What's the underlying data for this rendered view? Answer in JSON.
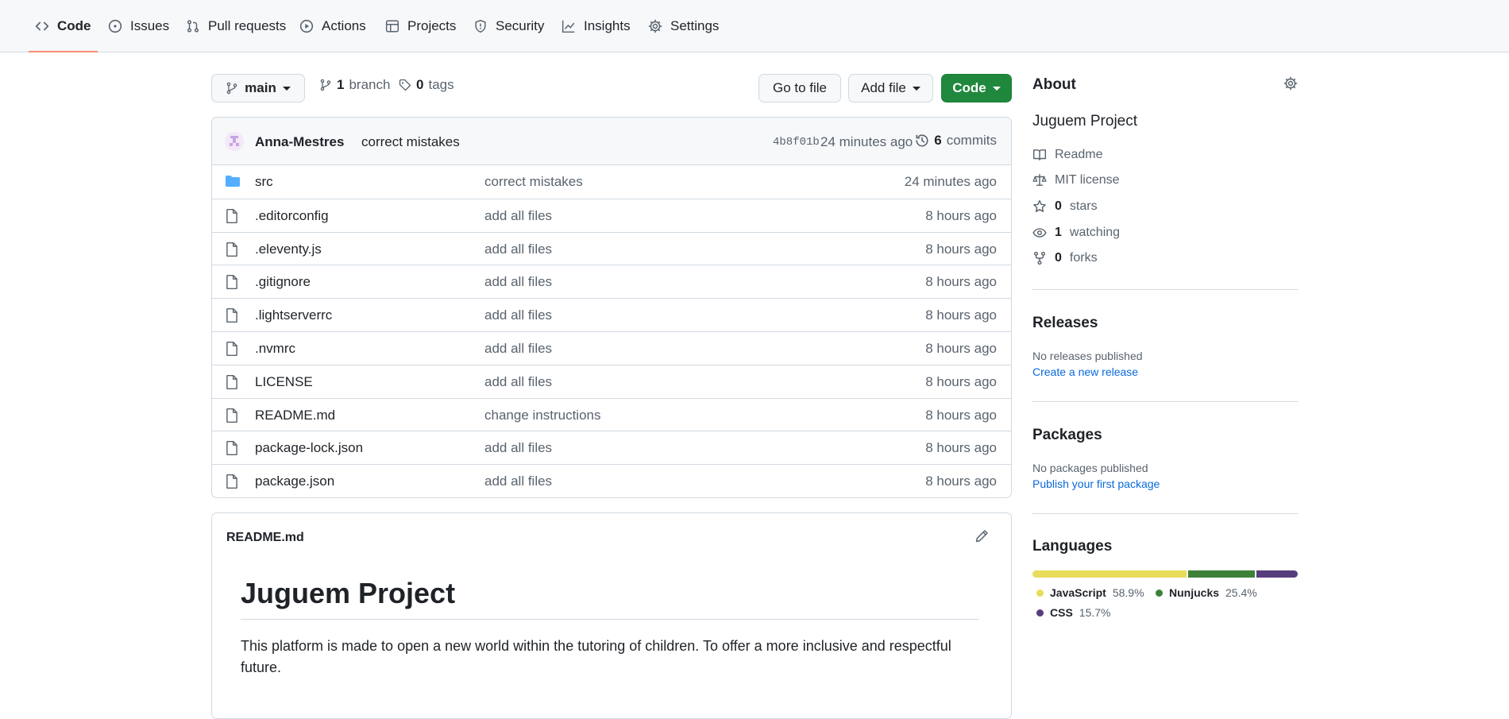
{
  "nav": {
    "tabs": [
      {
        "label": "Code",
        "icon": "code-icon"
      },
      {
        "label": "Issues",
        "icon": "issue-icon"
      },
      {
        "label": "Pull requests",
        "icon": "pull-request-icon"
      },
      {
        "label": "Actions",
        "icon": "play-icon"
      },
      {
        "label": "Projects",
        "icon": "table-icon"
      },
      {
        "label": "Security",
        "icon": "shield-icon"
      },
      {
        "label": "Insights",
        "icon": "graph-icon"
      },
      {
        "label": "Settings",
        "icon": "gear-icon"
      }
    ],
    "active": "Code"
  },
  "toolbar": {
    "branch": "main",
    "branch_count": "1",
    "branch_label": "branch",
    "tag_count": "0",
    "tag_label": "tags",
    "go_to_file": "Go to file",
    "add_file": "Add file",
    "code": "Code"
  },
  "commit": {
    "author": "Anna-Mestres",
    "message": "correct mistakes",
    "sha": "4b8f01b",
    "time": "24 minutes ago",
    "count": "6",
    "count_label": "commits"
  },
  "files": [
    {
      "name": "src",
      "type": "folder",
      "message": "correct mistakes",
      "time": "24 minutes ago"
    },
    {
      "name": ".editorconfig",
      "type": "file",
      "message": "add all files",
      "time": "8 hours ago"
    },
    {
      "name": ".eleventy.js",
      "type": "file",
      "message": "add all files",
      "time": "8 hours ago"
    },
    {
      "name": ".gitignore",
      "type": "file",
      "message": "add all files",
      "time": "8 hours ago"
    },
    {
      "name": ".lightserverrc",
      "type": "file",
      "message": "add all files",
      "time": "8 hours ago"
    },
    {
      "name": ".nvmrc",
      "type": "file",
      "message": "add all files",
      "time": "8 hours ago"
    },
    {
      "name": "LICENSE",
      "type": "file",
      "message": "add all files",
      "time": "8 hours ago"
    },
    {
      "name": "README.md",
      "type": "file",
      "message": "change instructions",
      "time": "8 hours ago"
    },
    {
      "name": "package-lock.json",
      "type": "file",
      "message": "add all files",
      "time": "8 hours ago"
    },
    {
      "name": "package.json",
      "type": "file",
      "message": "add all files",
      "time": "8 hours ago"
    }
  ],
  "readme": {
    "filename": "README.md",
    "title": "Juguem Project",
    "body": "This platform is made to open a new world within the tutoring of children. To offer a more inclusive and respectful future."
  },
  "about": {
    "title": "About",
    "description": "Juguem Project",
    "readme": "Readme",
    "license": "MIT license",
    "stars_count": "0",
    "stars_label": "stars",
    "watching_count": "1",
    "watching_label": "watching",
    "forks_count": "0",
    "forks_label": "forks"
  },
  "releases": {
    "title": "Releases",
    "empty": "No releases published",
    "link": "Create a new release"
  },
  "packages": {
    "title": "Packages",
    "empty": "No packages published",
    "link": "Publish your first package"
  },
  "languages": {
    "title": "Languages",
    "items": [
      {
        "name": "JavaScript",
        "percent": "58.9%",
        "value": 58.9,
        "color": "#e8dc5b"
      },
      {
        "name": "Nunjucks",
        "percent": "25.4%",
        "value": 25.4,
        "color": "#3d8138"
      },
      {
        "name": "CSS",
        "percent": "15.7%",
        "value": 15.7,
        "color": "#563d7c"
      }
    ]
  },
  "colors": {
    "accent_underline": "#fd8c73",
    "primary_button": "#1f883d",
    "link": "#0969da",
    "folder": "#54aeff"
  }
}
